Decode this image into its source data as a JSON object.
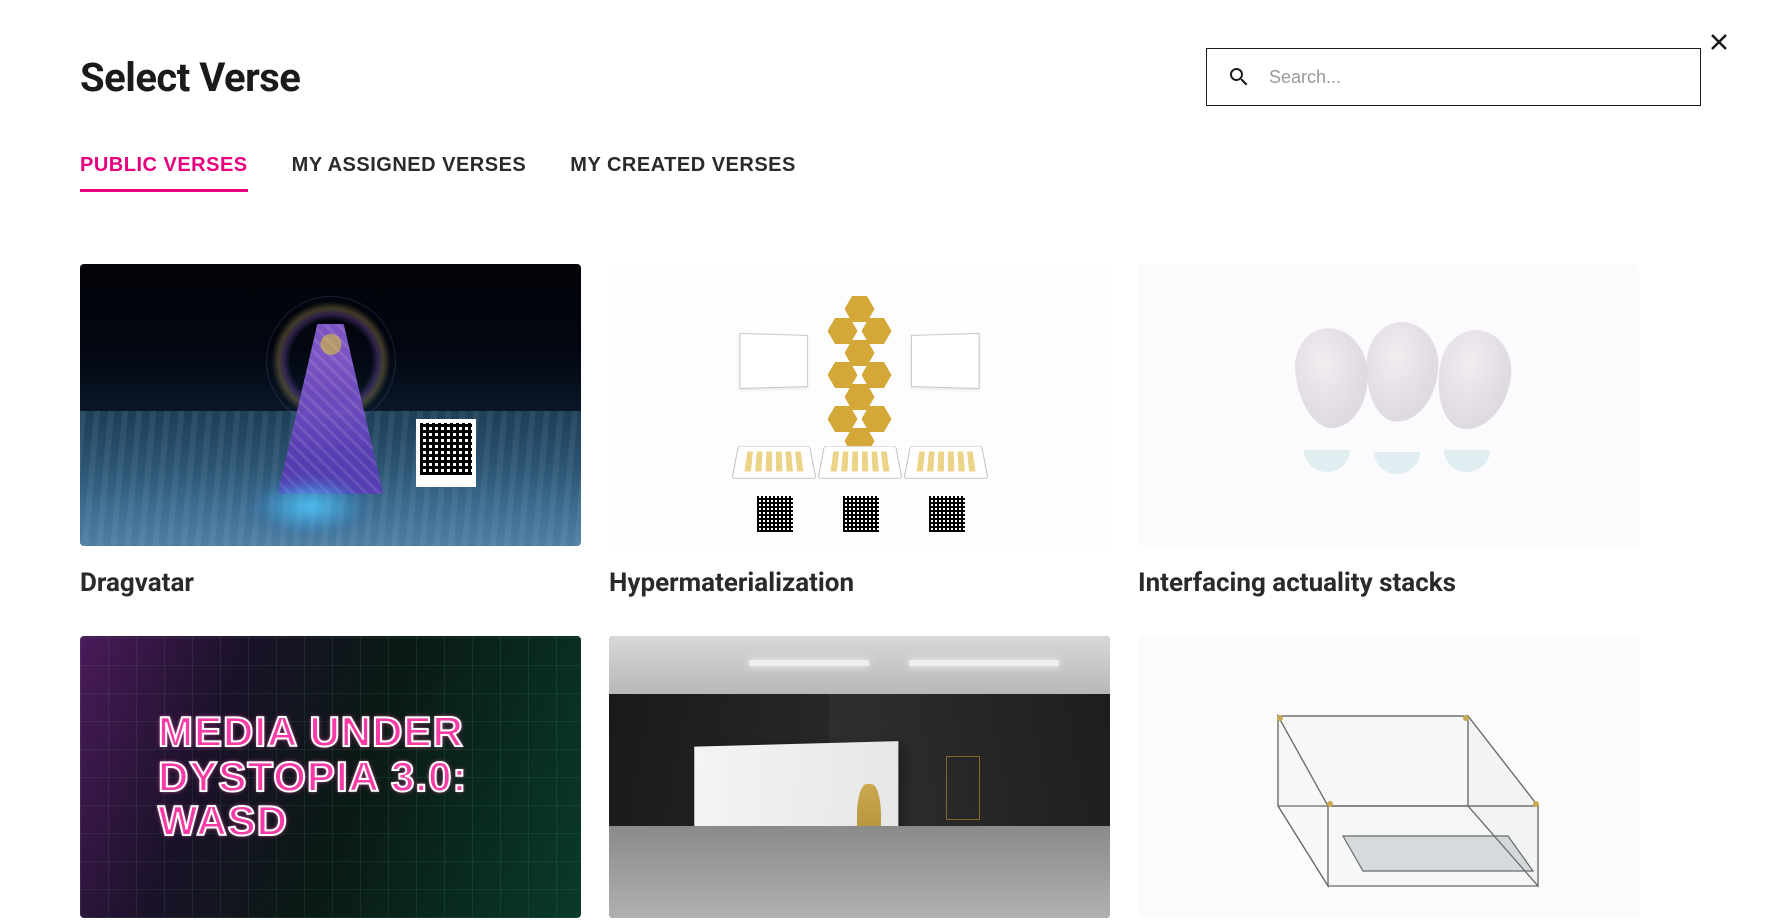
{
  "page_title": "Select Verse",
  "search": {
    "placeholder": "Search..."
  },
  "tabs": [
    {
      "label": "PUBLIC VERSES",
      "active": true
    },
    {
      "label": "MY ASSIGNED VERSES",
      "active": false
    },
    {
      "label": "MY CREATED VERSES",
      "active": false
    }
  ],
  "cards": [
    {
      "title": "Dragvatar",
      "thumb_overlay_text": ""
    },
    {
      "title": "Hypermaterialization",
      "thumb_overlay_text": ""
    },
    {
      "title": "Interfacing actuality stacks",
      "thumb_overlay_text": ""
    },
    {
      "title": "",
      "thumb_overlay_text": "MEDIA UNDER\nDYSTOPIA 3.0:\nWASD"
    },
    {
      "title": "",
      "thumb_overlay_text": ""
    },
    {
      "title": "",
      "thumb_overlay_text": ""
    }
  ],
  "colors": {
    "accent": "#e6007e",
    "text": "#1a1a1a"
  }
}
